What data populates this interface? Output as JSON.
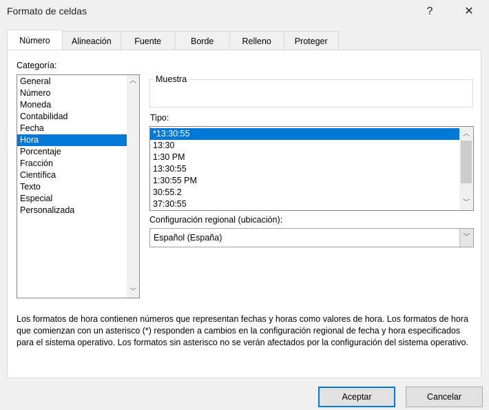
{
  "window": {
    "title": "Formato de celdas",
    "help": "?",
    "close": "✕"
  },
  "tabs": [
    "Número",
    "Alineación",
    "Fuente",
    "Borde",
    "Relleno",
    "Proteger"
  ],
  "category": {
    "label": "Categoría:",
    "items": [
      "General",
      "Número",
      "Moneda",
      "Contabilidad",
      "Fecha",
      "Hora",
      "Porcentaje",
      "Fracción",
      "Científica",
      "Texto",
      "Especial",
      "Personalizada"
    ],
    "selected": "Hora"
  },
  "sample": {
    "label": "Muestra",
    "value": ""
  },
  "type": {
    "label": "Tipo:",
    "items": [
      "*13:30:55",
      "13:30",
      "1:30 PM",
      "13:30:55",
      "1:30:55 PM",
      "30:55.2",
      "37:30:55"
    ],
    "selected": "*13:30:55"
  },
  "locale": {
    "label": "Configuración regional (ubicación):",
    "value": "Español (España)"
  },
  "description": "Los formatos de hora contienen números que representan fechas y horas como valores de hora. Los formatos de hora que comienzan con un asterisco (*) responden a cambios en la configuración regional de fecha y hora especificados para el sistema operativo. Los formatos sin asterisco no se verán afectados por la configuración del sistema operativo.",
  "buttons": {
    "ok": "Aceptar",
    "cancel": "Cancelar"
  },
  "colors": {
    "selection": "#0078d7",
    "accent_border": "#0078d7"
  }
}
